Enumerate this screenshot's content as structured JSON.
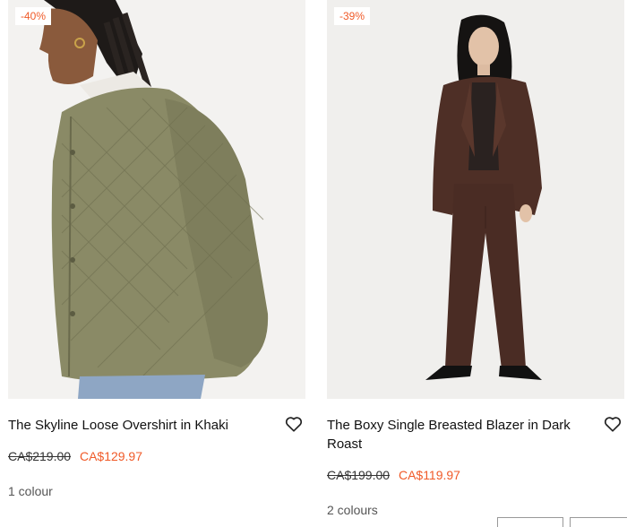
{
  "products": [
    {
      "badge": "-40%",
      "title": "The Skyline Loose Overshirt in Khaki",
      "original_price": "CA$219.00",
      "sale_price": "CA$129.97",
      "colours": "1 colour",
      "image_icon": "product-photo-khaki-overshirt",
      "wishlist_icon": "heart-outline-icon"
    },
    {
      "badge": "-39%",
      "title": "The Boxy Single Breasted Blazer in Dark Roast",
      "original_price": "CA$199.00",
      "sale_price": "CA$119.97",
      "colours": "2 colours",
      "image_icon": "product-photo-brown-suit",
      "wishlist_icon": "heart-outline-icon"
    }
  ],
  "colors": {
    "sale_accent": "#f05a28",
    "image_background": "#f1f0ee",
    "jacket_khaki": "#8a8a66",
    "suit_brown": "#4e2f26"
  }
}
